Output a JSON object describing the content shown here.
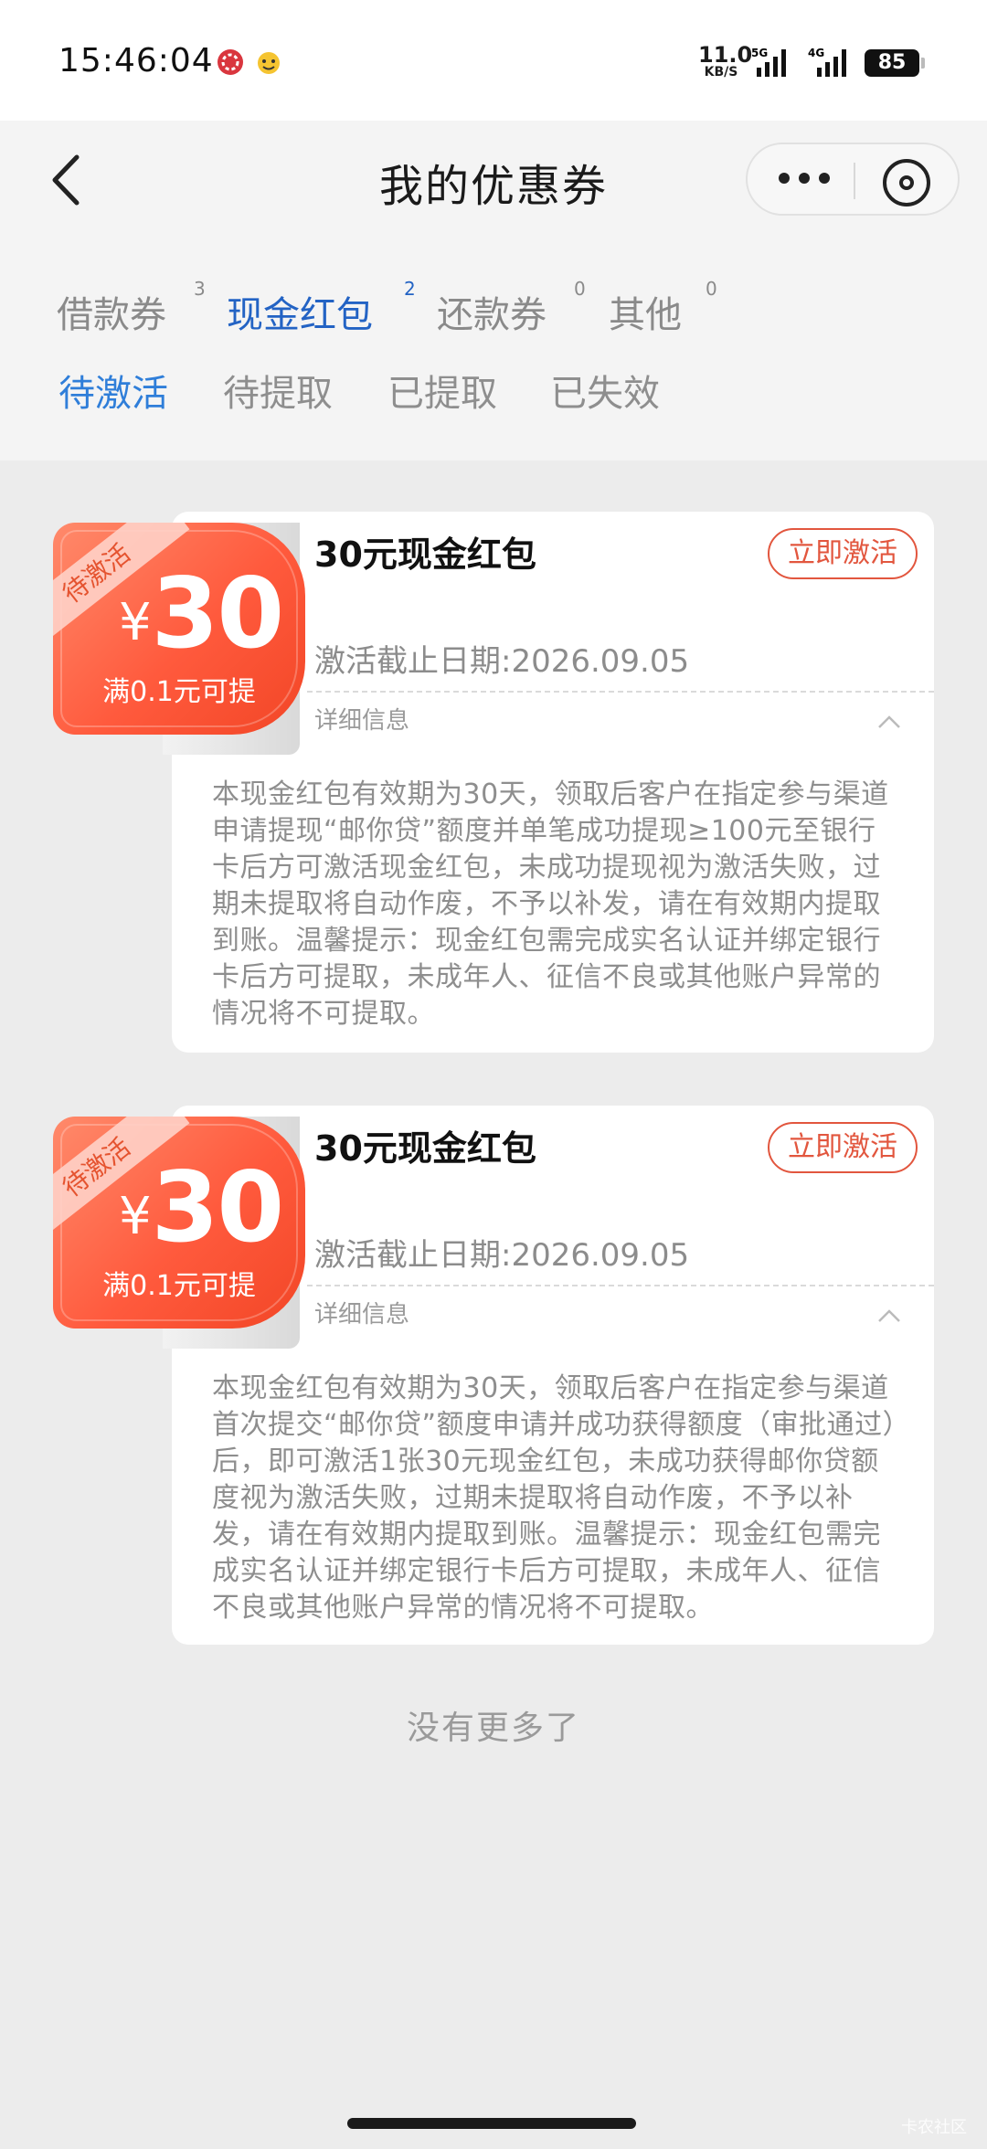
{
  "status_bar": {
    "time": "15:46:04",
    "net_speed_value": "11.0",
    "net_speed_unit": "KB/S",
    "signal1_label": "5G",
    "signal2_label": "4G",
    "battery": "85",
    "app_icons": [
      "app-notification-icon",
      "app-emoji-icon"
    ]
  },
  "header": {
    "title": "我的优惠券",
    "back_icon": "chevron-left-icon",
    "more_icon": "more-dots-icon",
    "close_icon": "close-circle-icon"
  },
  "tabs": [
    {
      "label": "借款券",
      "count": "3",
      "active": false
    },
    {
      "label": "现金红包",
      "count": "2",
      "active": true
    },
    {
      "label": "还款券",
      "count": "0",
      "active": false
    },
    {
      "label": "其他",
      "count": "0",
      "active": false
    }
  ],
  "subtabs": [
    {
      "label": "待激活",
      "active": true
    },
    {
      "label": "待提取",
      "active": false
    },
    {
      "label": "已提取",
      "active": false
    },
    {
      "label": "已失效",
      "active": false
    }
  ],
  "coupons": [
    {
      "ribbon": "待激活",
      "currency": "¥",
      "amount": "30",
      "condition": "满0.1元可提",
      "title": "30元现金红包",
      "button": "立即激活",
      "deadline": "激活截止日期:2026.09.05",
      "detail_label": "详细信息",
      "description": "本现金红包有效期为30天，领取后客户在指定参与渠道申请提现“邮你贷”额度并单笔成功提现≥100元至银行卡后方可激活现金红包，未成功提现视为激活失败，过期未提取将自动作废，不予以补发，请在有效期内提取到账。温馨提示：现金红包需完成实名认证并绑定银行卡后方可提取，未成年人、征信不良或其他账户异常的情况将不可提取。"
    },
    {
      "ribbon": "待激活",
      "currency": "¥",
      "amount": "30",
      "condition": "满0.1元可提",
      "title": "30元现金红包",
      "button": "立即激活",
      "deadline": "激活截止日期:2026.09.05",
      "detail_label": "详细信息",
      "description": "本现金红包有效期为30天，领取后客户在指定参与渠道首次提交“邮你贷”额度申请并成功获得额度（审批通过）后，即可激活1张30元现金红包，未成功获得邮你贷额度视为激活失败，过期未提取将自动作废，不予以补发，请在有效期内提取到账。温馨提示：现金红包需完成实名认证并绑定银行卡后方可提取，未成年人、征信不良或其他账户异常的情况将不可提取。"
    }
  ],
  "footer": {
    "no_more": "没有更多了",
    "watermark": "卡农社区"
  },
  "colors": {
    "accent_blue": "#2363c4",
    "coupon_red": "#ff5a3d",
    "button_red": "#e2563e"
  }
}
